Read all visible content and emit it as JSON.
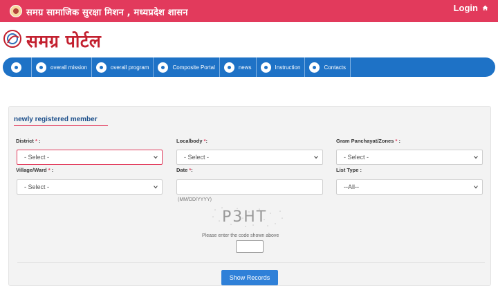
{
  "header": {
    "org_name": "समग्र सामाजिक सुरक्षा मिशन , मध्यप्रदेश शासन",
    "login_label": "Login"
  },
  "logo": {
    "text": "समग्र पोर्टल"
  },
  "nav": {
    "items": [
      {
        "label": ""
      },
      {
        "label": "overall mission"
      },
      {
        "label": "overall program"
      },
      {
        "label": "Composite Portal"
      },
      {
        "label": "news"
      },
      {
        "label": "Instruction"
      },
      {
        "label": "Contacts"
      }
    ]
  },
  "form": {
    "title": "newly registered member",
    "district": {
      "label": "District",
      "required": "*",
      "suffix": ":",
      "value": "- Select -"
    },
    "localbody": {
      "label": "Localbody",
      "required": "*",
      "suffix": ":",
      "value": "- Select -"
    },
    "gram": {
      "label": "Gram Panchayat/Zones",
      "required": "*",
      "suffix": ":",
      "value": "- Select -"
    },
    "village": {
      "label": "Village/Ward",
      "required": "*",
      "suffix": ":",
      "value": "- Select -"
    },
    "date": {
      "label": "Date",
      "required": "*",
      "suffix": ":",
      "value": "",
      "hint": "(MM/DD/YYYY)"
    },
    "list_type": {
      "label": "List Type",
      "suffix": ":",
      "value": "--All--"
    },
    "captcha_code": "P3HT",
    "captcha_hint": "Please enter the code shown above",
    "captcha_value": "",
    "submit_label": "Show Records"
  },
  "colors": {
    "topbar": "#e23a5c",
    "nav": "#1e72c6",
    "title": "#1b4e8a",
    "button": "#2f80d8"
  }
}
